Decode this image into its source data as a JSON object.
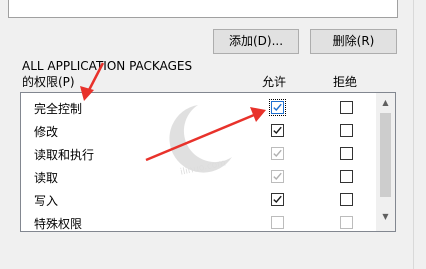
{
  "buttons": {
    "add_label": "添加(D)...",
    "remove_label": "删除(R)"
  },
  "permissions_panel": {
    "principal": "ALL APPLICATION PACKAGES",
    "title_suffix": "的权限(P)",
    "col_allow": "允许",
    "col_deny": "拒绝",
    "rows": [
      {
        "name": "完全控制",
        "allow": true,
        "allow_enabled": true,
        "deny": false,
        "focused": true
      },
      {
        "name": "修改",
        "allow": true,
        "allow_enabled": true,
        "deny": false
      },
      {
        "name": "读取和执行",
        "allow": true,
        "allow_enabled": false,
        "deny": false
      },
      {
        "name": "读取",
        "allow": true,
        "allow_enabled": false,
        "deny": false
      },
      {
        "name": "写入",
        "allow": true,
        "allow_enabled": true,
        "deny": false
      },
      {
        "name": "特殊权限",
        "allow": false,
        "allow_enabled": false,
        "deny": false
      }
    ]
  },
  "watermark": {
    "line1": "",
    "line2": "ilinuo.com"
  },
  "colors": {
    "annotation_arrow": "#e8322b",
    "checkmark_enabled": "#1a1a1a",
    "checkmark_disabled": "#b0b0b0"
  }
}
